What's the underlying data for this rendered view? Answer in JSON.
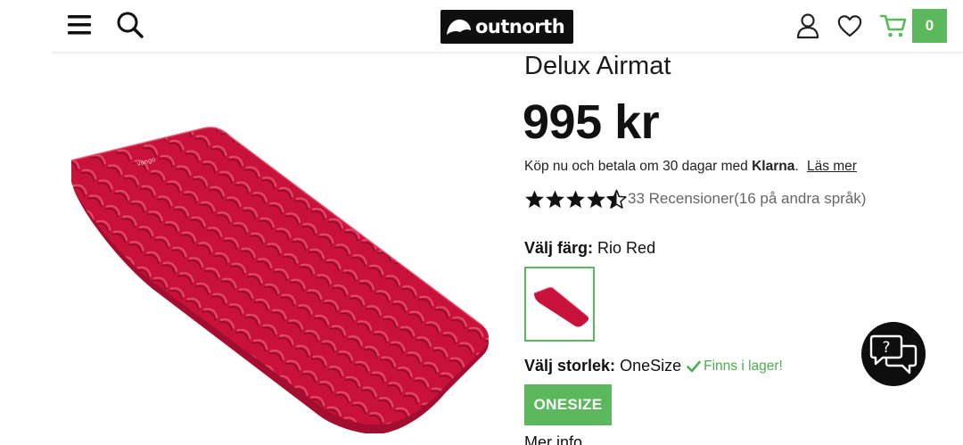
{
  "header": {
    "logo_text": "outnorth",
    "cart_count": "0"
  },
  "product": {
    "title": "Delux Airmat",
    "price": "995 kr",
    "klarna": {
      "text": "Köp nu och betala om 30 dagar med",
      "brand": "Klarna",
      "punct": ".",
      "read_more": "Läs mer"
    },
    "rating": {
      "stars": 4.5,
      "reviews": "33 Recensioner",
      "extra": "(16 på andra språk)"
    },
    "color": {
      "label": "Välj färg:",
      "value": "Rio Red"
    },
    "size": {
      "label": "Välj storlek:",
      "value": "OneSize",
      "stock": "Finns i lager!",
      "option": "ONESIZE"
    },
    "more_info": "Mer info"
  },
  "icons": {
    "menu": "hamburger-menu-icon",
    "search": "search-icon",
    "account": "user-icon",
    "wishlist": "heart-icon",
    "cart": "cart-icon",
    "chat": "chat-help-icon",
    "stock": "checkmark-icon"
  },
  "colors": {
    "accent_green": "#5cb85c",
    "product_red": "#c8123a",
    "logo_bg": "#0f0f0f"
  }
}
